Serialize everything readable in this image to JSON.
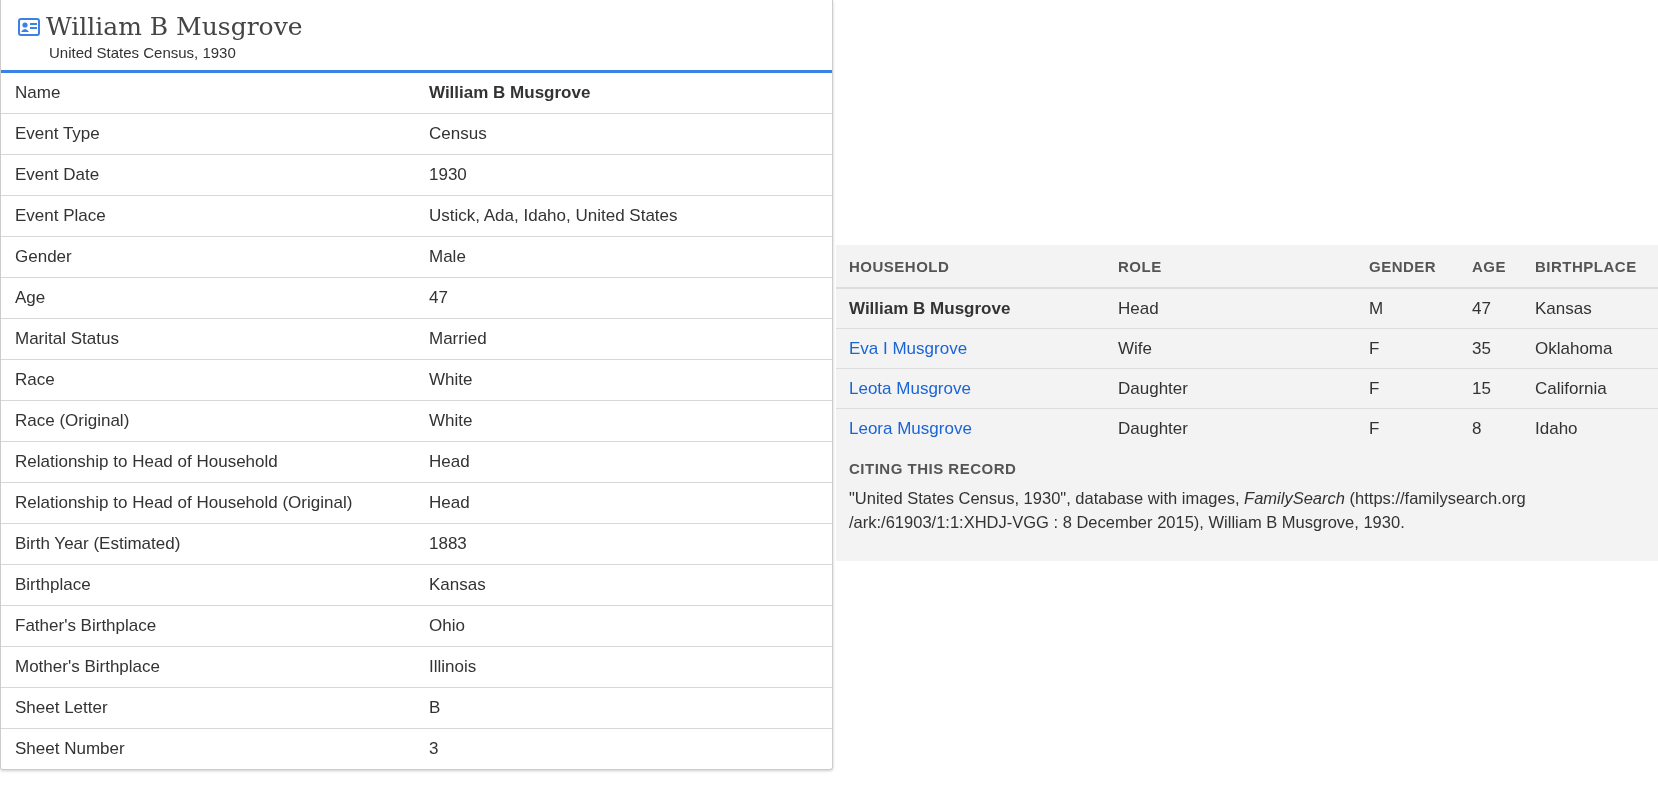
{
  "record": {
    "title": "William B Musgrove",
    "subtitle": "United States Census, 1930"
  },
  "fields": [
    {
      "label": "Name",
      "value": "William B Musgrove",
      "emphasized": true
    },
    {
      "label": "Event Type",
      "value": "Census",
      "emphasized": false
    },
    {
      "label": "Event Date",
      "value": "1930",
      "emphasized": false
    },
    {
      "label": "Event Place",
      "value": "Ustick, Ada, Idaho, United States",
      "emphasized": false
    },
    {
      "label": "Gender",
      "value": "Male",
      "emphasized": false
    },
    {
      "label": "Age",
      "value": "47",
      "emphasized": false
    },
    {
      "label": "Marital Status",
      "value": "Married",
      "emphasized": false
    },
    {
      "label": "Race",
      "value": "White",
      "emphasized": false
    },
    {
      "label": "Race (Original)",
      "value": "White",
      "emphasized": false
    },
    {
      "label": "Relationship to Head of Household",
      "value": "Head",
      "emphasized": false
    },
    {
      "label": "Relationship to Head of Household (Original)",
      "value": "Head",
      "emphasized": false
    },
    {
      "label": "Birth Year (Estimated)",
      "value": "1883",
      "emphasized": false
    },
    {
      "label": "Birthplace",
      "value": "Kansas",
      "emphasized": false
    },
    {
      "label": "Father's Birthplace",
      "value": "Ohio",
      "emphasized": false
    },
    {
      "label": "Mother's Birthplace",
      "value": "Illinois",
      "emphasized": false
    },
    {
      "label": "Sheet Letter",
      "value": "B",
      "emphasized": false
    },
    {
      "label": "Sheet Number",
      "value": "3",
      "emphasized": false
    }
  ],
  "household": {
    "columns": [
      "HOUSEHOLD",
      "ROLE",
      "GENDER",
      "AGE",
      "BIRTHPLACE"
    ],
    "rows": [
      {
        "name": "William B Musgrove",
        "linked": false,
        "role": "Head",
        "gender": "M",
        "age": "47",
        "birthplace": "Kansas"
      },
      {
        "name": "Eva I Musgrove",
        "linked": true,
        "role": "Wife",
        "gender": "F",
        "age": "35",
        "birthplace": "Oklahoma"
      },
      {
        "name": "Leota Musgrove",
        "linked": true,
        "role": "Daughter",
        "gender": "F",
        "age": "15",
        "birthplace": "California"
      },
      {
        "name": "Leora Musgrove",
        "linked": true,
        "role": "Daughter",
        "gender": "F",
        "age": "8",
        "birthplace": "Idaho"
      }
    ]
  },
  "citation": {
    "heading": "CITING THIS RECORD",
    "text": "\"United States Census, 1930\", database with images, *FamilySearch* (https://familysearch.org /ark:/61903/1:1:XHDJ-VGG : 8 December 2015), William B Musgrove, 1930."
  }
}
